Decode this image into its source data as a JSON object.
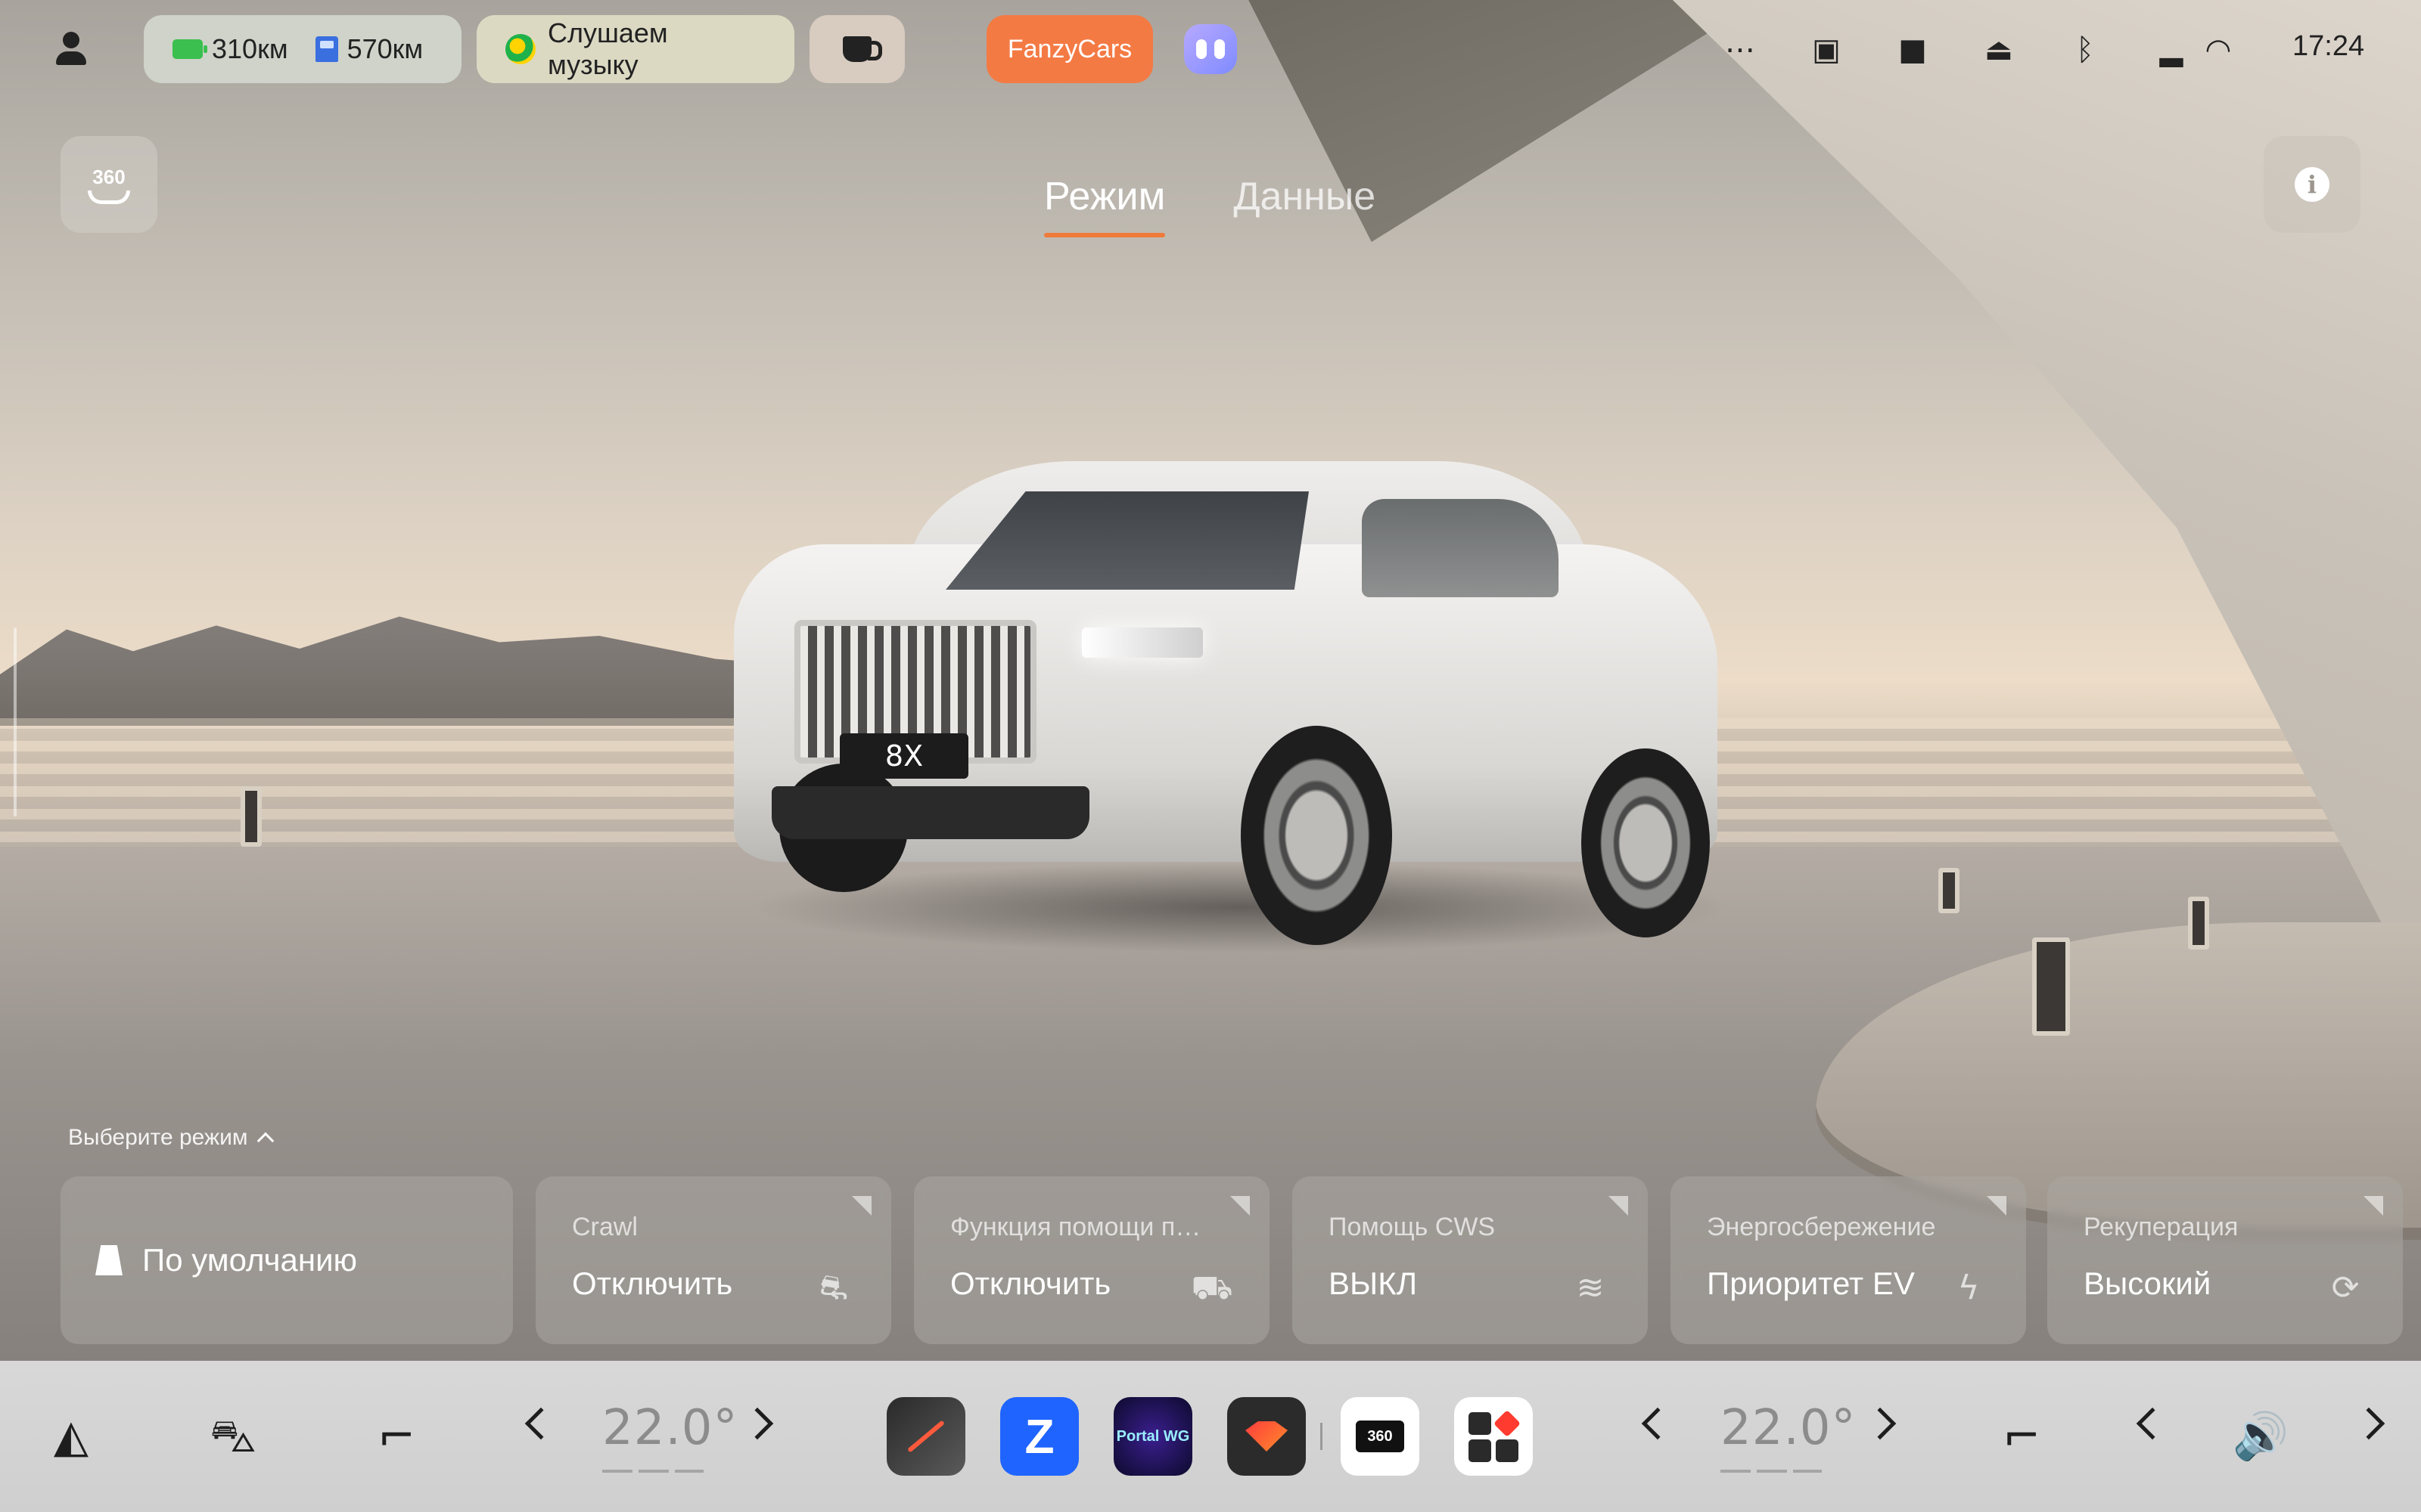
{
  "status_bar": {
    "electric_range": "310км",
    "fuel_range": "570км",
    "music_label": "Слушаем музыку",
    "app_chip": "FanzyCars",
    "time": "17:24",
    "icons": [
      "more-icon",
      "split-screen-icon",
      "camera-icon",
      "alarm-icon",
      "bluetooth-icon",
      "signal-icon",
      "wifi-icon"
    ]
  },
  "header": {
    "view_360_label": "360",
    "tabs": [
      {
        "label": "Режим",
        "active": true
      },
      {
        "label": "Данные",
        "active": false
      }
    ]
  },
  "vehicle": {
    "plate": "8X"
  },
  "modes": {
    "section_label": "Выберите режим",
    "default_card": {
      "label": "По умолчанию"
    },
    "cards": [
      {
        "title": "Crawl",
        "value": "Отключить",
        "icon": "crawl-car-icon"
      },
      {
        "title": "Функция помощи п…",
        "value": "Отключить",
        "icon": "hill-assist-icon"
      },
      {
        "title": "Помощь CWS",
        "value": "ВЫКЛ",
        "icon": "cws-assist-icon"
      },
      {
        "title": "Энергосбережение",
        "value": "Приоритет EV",
        "icon": "lightning-icon"
      },
      {
        "title": "Рекуперация",
        "value": "Высокий",
        "icon": "regen-icon"
      }
    ]
  },
  "dock": {
    "left_temp": "22.0°",
    "right_temp": "22.0°",
    "apps": [
      {
        "name": "navigation-app"
      },
      {
        "name": "z-app",
        "glyph": "Z"
      },
      {
        "name": "portal-wg-app",
        "label": "Portal WG"
      },
      {
        "name": "gem-app"
      },
      {
        "name": "camera-360-app",
        "label": "360"
      },
      {
        "name": "apps-grid"
      }
    ]
  },
  "colors": {
    "accent": "#f07a3a",
    "fanzy": "#f47a44",
    "battery": "#3bbf4f",
    "fuel": "#3a6fe0"
  }
}
